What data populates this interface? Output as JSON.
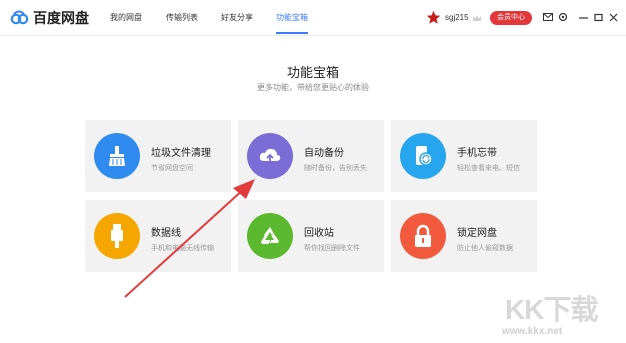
{
  "app": {
    "name": "百度网盘"
  },
  "nav": [
    {
      "label": "我的网盘"
    },
    {
      "label": "传输列表"
    },
    {
      "label": "好友分享"
    },
    {
      "label": "功能宝箱"
    }
  ],
  "user": {
    "name": "sgj215",
    "vip_label": "会员中心"
  },
  "main": {
    "title": "功能宝箱",
    "subtitle": "更多功能，带给您更贴心的体验"
  },
  "features": [
    {
      "title": "垃圾文件清理",
      "desc": "节省网盘空间",
      "color": "#2f8bf0",
      "icon": "broom-icon"
    },
    {
      "title": "自动备份",
      "desc": "随时备份，告别丢失",
      "color": "#7b6cd6",
      "icon": "cloud-upload-icon"
    },
    {
      "title": "手机忘带",
      "desc": "轻松查看来电、短信",
      "color": "#27a5ee",
      "icon": "phone-sync-icon"
    },
    {
      "title": "数据线",
      "desc": "手机和电脑无线传输",
      "color": "#f5a600",
      "icon": "usb-icon"
    },
    {
      "title": "回收站",
      "desc": "帮你找回删除文件",
      "color": "#5cb82e",
      "icon": "recycle-icon"
    },
    {
      "title": "锁定网盘",
      "desc": "防止他人偷窥数据",
      "color": "#f15a3c",
      "icon": "lock-icon"
    }
  ],
  "watermark": {
    "text": "KK下载",
    "url": "www.kkx.net"
  },
  "colors": {
    "accent": "#3b7cff",
    "annotation_arrow": "#e23b3b",
    "vip": "#e3383b"
  }
}
